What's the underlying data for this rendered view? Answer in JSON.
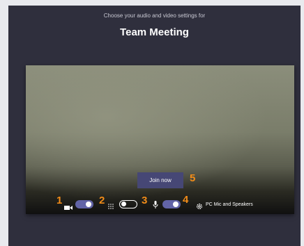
{
  "header": {
    "subtitle": "Choose your audio and video settings for",
    "meeting_title": "Team Meeting"
  },
  "preview": {
    "join_label": "Join now"
  },
  "controls": {
    "video": {
      "toggle_on": true,
      "icon": "video-camera-icon"
    },
    "blur": {
      "toggle_on": false,
      "icon": "background-blur-icon"
    },
    "mic": {
      "toggle_on": true,
      "icon": "microphone-icon"
    },
    "device": {
      "icon": "gear-icon",
      "label": "PC Mic and Speakers"
    }
  },
  "annotations": [
    "1",
    "2",
    "3",
    "4",
    "5"
  ],
  "colors": {
    "accent": "#6264a7",
    "join_button": "#464775",
    "annotation": "#f28c18",
    "background": "#2f2f3d"
  }
}
